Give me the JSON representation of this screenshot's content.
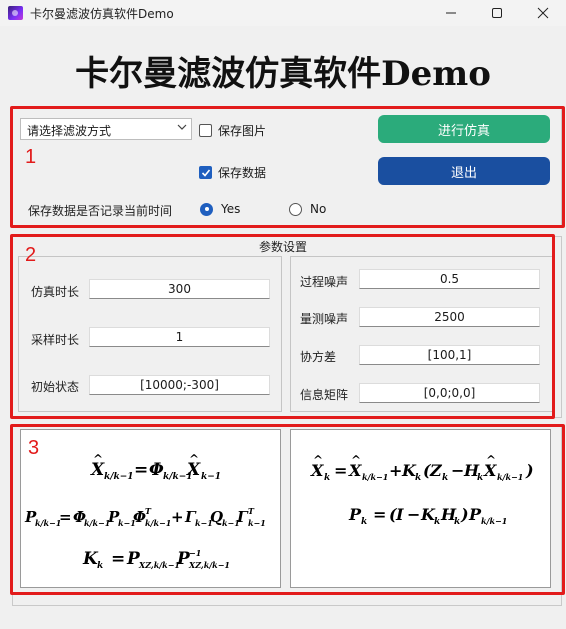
{
  "window": {
    "title": "卡尔曼滤波仿真软件Demo",
    "minimize_icon": "minimize-icon",
    "maximize_icon": "maximize-icon",
    "close_icon": "close-icon"
  },
  "header": {
    "title": "卡尔曼滤波仿真软件Demo"
  },
  "section1": {
    "marker": "1",
    "filter_select": {
      "value": "请选择滤波方式",
      "icon": "chevron-down-icon"
    },
    "save_image": {
      "label": "保存图片",
      "checked": false
    },
    "save_data": {
      "label": "保存数据",
      "checked": true
    },
    "run_button": {
      "label": "进行仿真",
      "color": "#2bab7b"
    },
    "exit_button": {
      "label": "退出",
      "color": "#1a4fa0"
    },
    "record_time_label": "保存数据是否记录当前时间",
    "radio_yes": {
      "label": "Yes",
      "selected": true
    },
    "radio_no": {
      "label": "No",
      "selected": false
    }
  },
  "section2": {
    "marker": "2",
    "title": "参数设置",
    "left": [
      {
        "label": "仿真时长",
        "value": "300"
      },
      {
        "label": "采样时长",
        "value": "1"
      },
      {
        "label": "初始状态",
        "value": "[10000;-300]"
      }
    ],
    "right": [
      {
        "label": "过程噪声",
        "value": "0.5"
      },
      {
        "label": "量测噪声",
        "value": "2500"
      },
      {
        "label": "协方差",
        "value": "[100,1]"
      },
      {
        "label": "信息矩阵",
        "value": "[0,0;0,0]"
      }
    ]
  },
  "section3": {
    "marker": "3"
  },
  "colors": {
    "highlight": "#e21b1b",
    "accent_blue": "#1f5fbf"
  }
}
